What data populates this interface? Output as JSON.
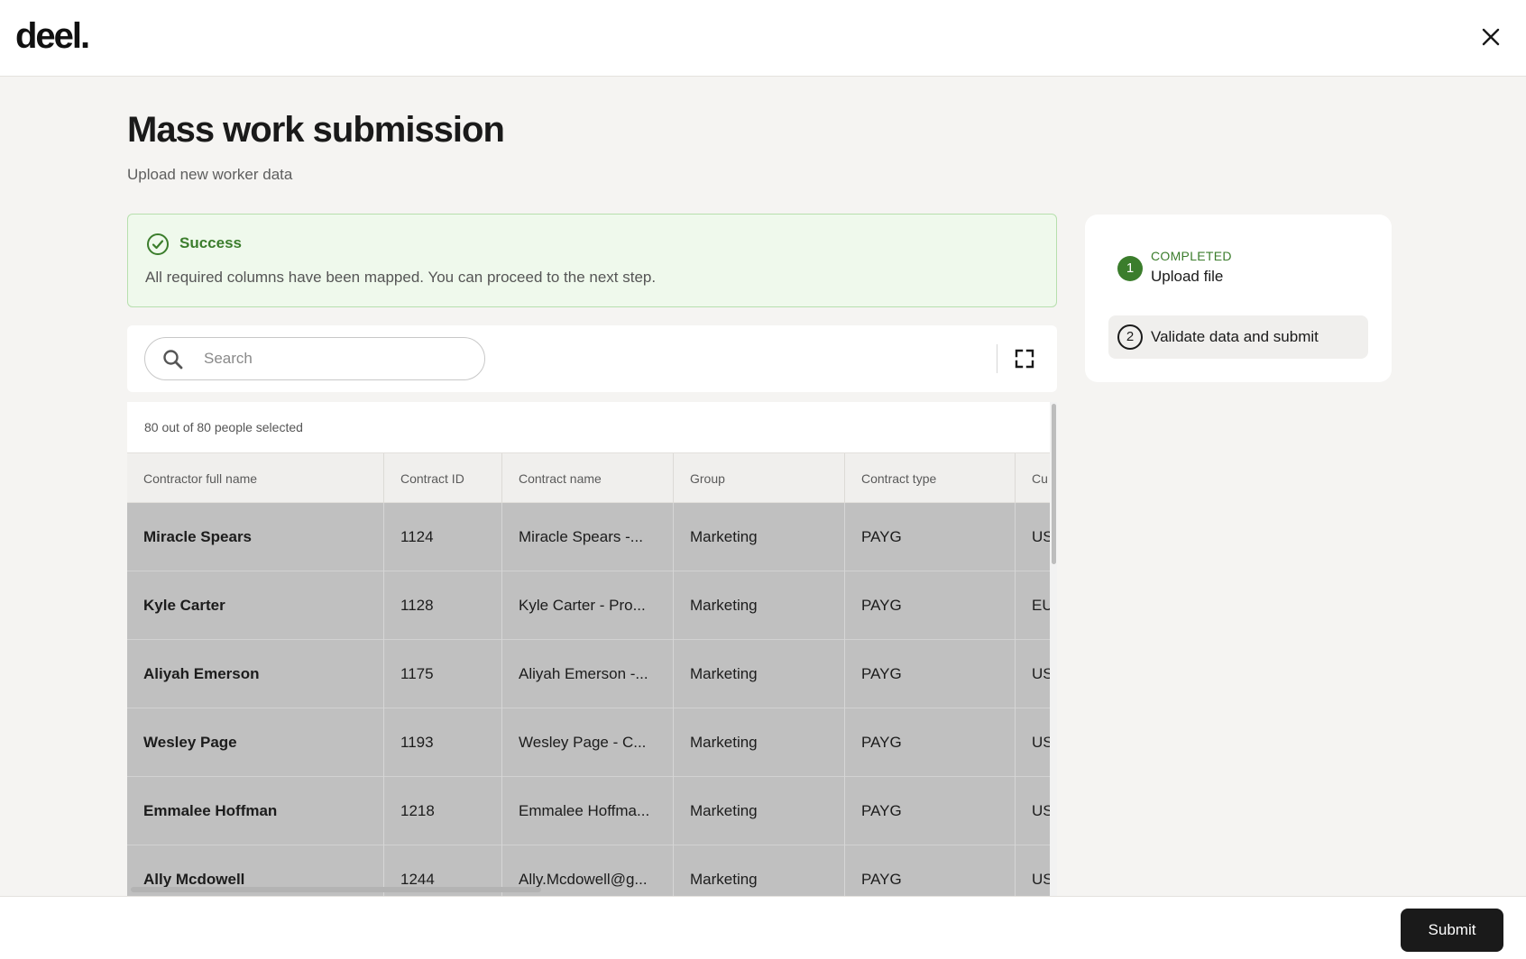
{
  "brand": {
    "logo_text": "deel."
  },
  "header": {
    "close_icon": "close-icon"
  },
  "page": {
    "title": "Mass work submission",
    "subtitle": "Upload new worker data"
  },
  "alert": {
    "status": "success",
    "title": "Success",
    "message": "All required columns have been mapped. You can proceed to the next step.",
    "color": "#3b7d2c",
    "background": "#eff9ec"
  },
  "search": {
    "placeholder": "Search",
    "value": ""
  },
  "table": {
    "selection_text": "80 out of 80 people selected",
    "columns": [
      "Contractor full name",
      "Contract ID",
      "Contract name",
      "Group",
      "Contract type",
      "Cu"
    ],
    "rows": [
      [
        "Miracle Spears",
        "1124",
        "Miracle Spears -...",
        "Marketing",
        "PAYG",
        "US"
      ],
      [
        "Kyle Carter",
        "1128",
        "Kyle Carter - Pro...",
        "Marketing",
        "PAYG",
        "EU"
      ],
      [
        "Aliyah Emerson",
        "1175",
        "Aliyah Emerson -...",
        "Marketing",
        "PAYG",
        "US"
      ],
      [
        "Wesley Page",
        "1193",
        "Wesley Page - C...",
        "Marketing",
        "PAYG",
        "US"
      ],
      [
        "Emmalee Hoffman",
        "1218",
        "Emmalee Hoffma...",
        "Marketing",
        "PAYG",
        "US"
      ],
      [
        "Ally Mcdowell",
        "1244",
        "Ally.Mcdowell@g...",
        "Marketing",
        "PAYG",
        "US"
      ]
    ]
  },
  "steps": [
    {
      "number": "1",
      "status": "COMPLETED",
      "label": "Upload file"
    },
    {
      "number": "2",
      "status": "",
      "label": "Validate data and submit"
    }
  ],
  "footer": {
    "submit_label": "Submit"
  },
  "colors": {
    "accent_green": "#3b7d2c",
    "primary_dark": "#1a1a1a",
    "row_selected": "#c0c0c0"
  }
}
